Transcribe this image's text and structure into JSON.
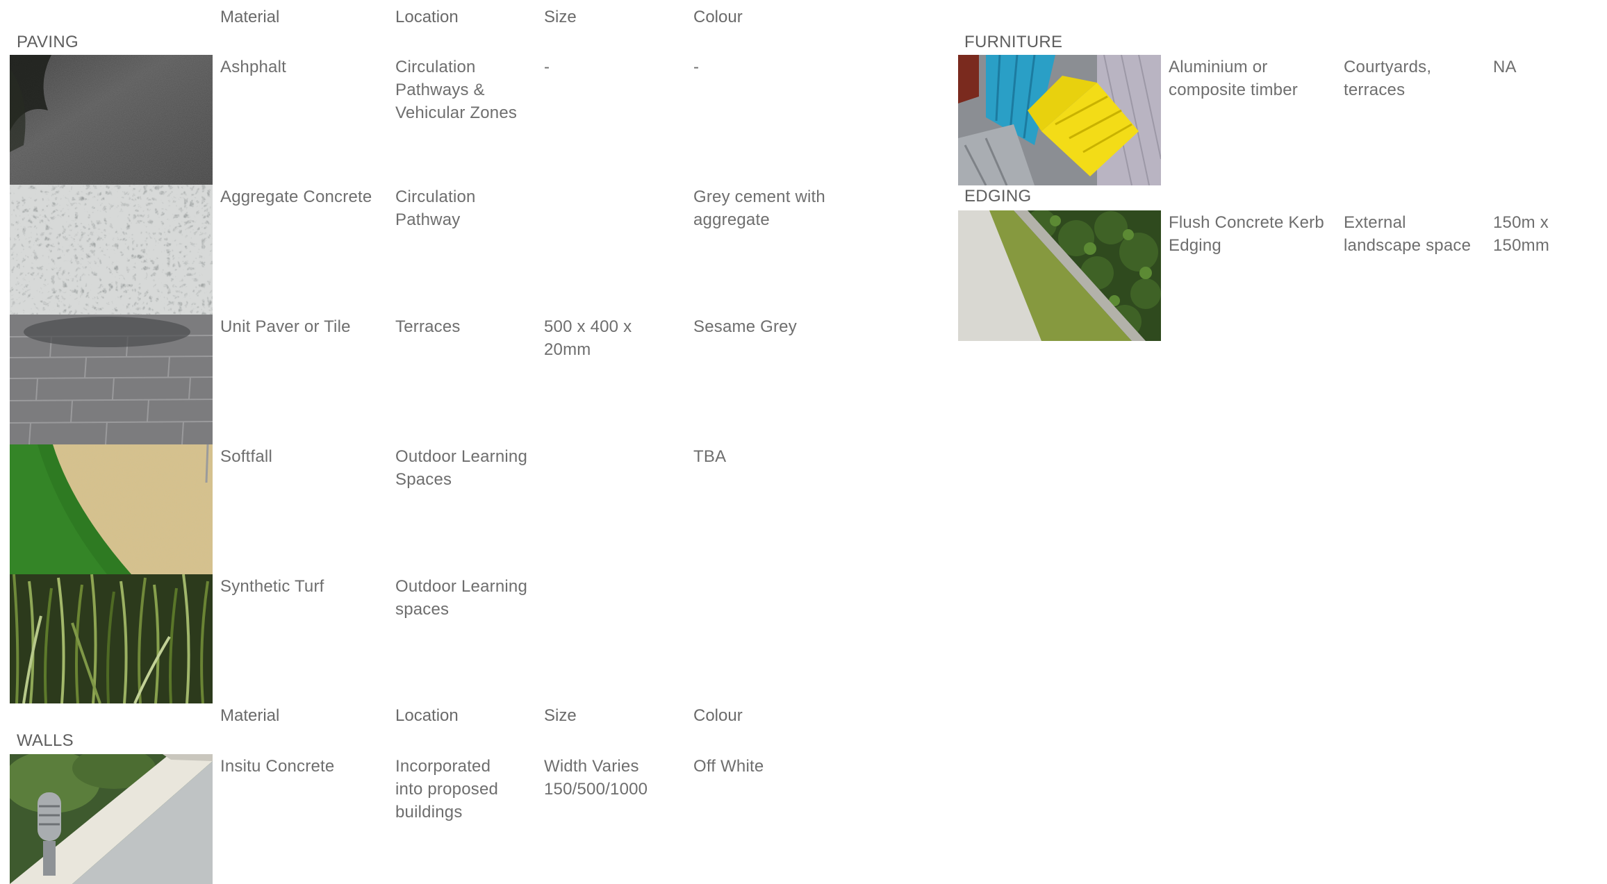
{
  "headers": {
    "material": "Material",
    "location": "Location",
    "size": "Size",
    "colour": "Colour"
  },
  "sections": {
    "paving": "PAVING",
    "walls": "WALLS",
    "furniture": "FURNITURE",
    "edging": "EDGING"
  },
  "paving": [
    {
      "material": "Ashphalt",
      "location": "Circulation\nPathways &\nVehicular Zones",
      "size": "-",
      "colour": "-",
      "swatch": "asphalt-swatch"
    },
    {
      "material": "Aggregate Concrete",
      "location": "Circulation\nPathway",
      "size": "",
      "colour": "Grey cement with\naggregate",
      "swatch": "aggregate-swatch"
    },
    {
      "material": "Unit Paver or Tile",
      "location": "Terraces",
      "size": "500 x 400 x\n20mm",
      "colour": "Sesame Grey",
      "swatch": "paver-swatch"
    },
    {
      "material": "Softfall",
      "location": "Outdoor Learning\nSpaces",
      "size": "",
      "colour": "TBA",
      "swatch": "softfall-swatch"
    },
    {
      "material": "Synthetic Turf",
      "location": "Outdoor Learning\nspaces",
      "size": "",
      "colour": "",
      "swatch": "turf-swatch"
    }
  ],
  "walls": [
    {
      "material": "Insitu Concrete",
      "location": "Incorporated\ninto proposed\nbuildings",
      "size": "Width Varies\n150/500/1000",
      "colour": "Off White",
      "swatch": "wall-swatch"
    }
  ],
  "furniture": [
    {
      "material": "Aluminium or\ncomposite timber",
      "location": "Courtyards,\nterraces",
      "size": "NA",
      "swatch": "chairs-swatch"
    }
  ],
  "edging": [
    {
      "material": "Flush Concrete Kerb\nEdging",
      "location": "External\nlandscape space",
      "size": "150m x 150mm",
      "swatch": "kerb-swatch"
    }
  ]
}
